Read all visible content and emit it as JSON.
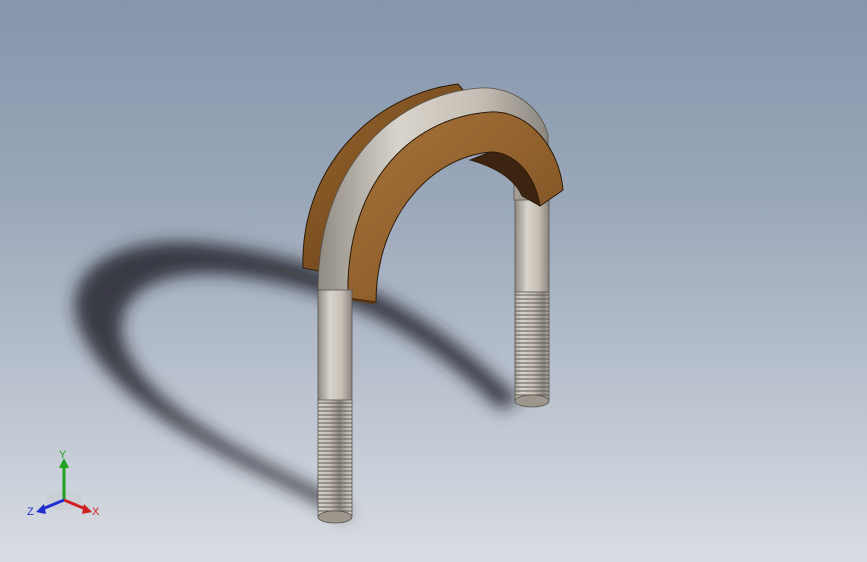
{
  "viewport": {
    "background_top": "#8696ac",
    "background_bottom": "#d9dde3"
  },
  "model": {
    "rod_color": "#c8c2b8",
    "saddle_color": "#8a5a26",
    "saddle_dark": "#4a2e12",
    "thread_color": "#b9b3aa"
  },
  "triad": {
    "x_label": "X",
    "y_label": "Y",
    "z_label": "Z",
    "x_color": "#d02020",
    "y_color": "#20a020",
    "z_color": "#2030d0"
  }
}
